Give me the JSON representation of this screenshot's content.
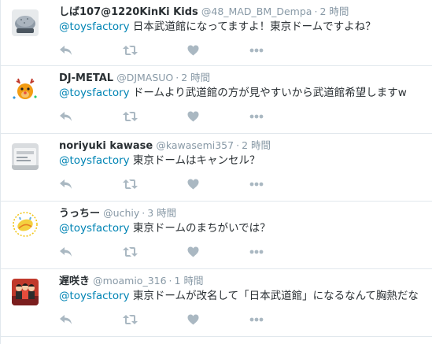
{
  "colors": {
    "mention": "#0084b4",
    "meta": "#8899a6",
    "icon": "#aab8c2",
    "divider": "#e1e8ed"
  },
  "tweets": [
    {
      "name": "しば107@1220KinKi Kids",
      "handle": "@48_MAD_BM_Dempa",
      "time": "2 時間",
      "mention": "@toysfactory",
      "text": " 日本武道館になってますよ！東京ドームですよね？",
      "avatar_icon": "cap-avatar"
    },
    {
      "name": "DJ-METAL",
      "handle": "@DJMASUO",
      "time": "2 時間",
      "mention": "@toysfactory",
      "text": " ドームより武道館の方が見やすいから武道館希望しますw",
      "avatar_icon": "reindeer-avatar"
    },
    {
      "name": "noriyuki kawase",
      "handle": "@kawasemi357",
      "time": "2 時間",
      "mention": "@toysfactory",
      "text": "  東京ドームはキャンセル？",
      "avatar_icon": "device-avatar"
    },
    {
      "name": "うっちー",
      "handle": "@uchiy",
      "time": "3 時間",
      "mention": "@toysfactory",
      "text": " 東京ドームのまちがいでは？",
      "avatar_icon": "lemon-avatar"
    },
    {
      "name": "遅咲き",
      "handle": "@moamio_316",
      "time": "1 時間",
      "mention": "@toysfactory",
      "text": " 東京ドームが改名して「日本武道館」になるなんて胸熱だな",
      "avatar_icon": "group-photo-avatar"
    }
  ]
}
